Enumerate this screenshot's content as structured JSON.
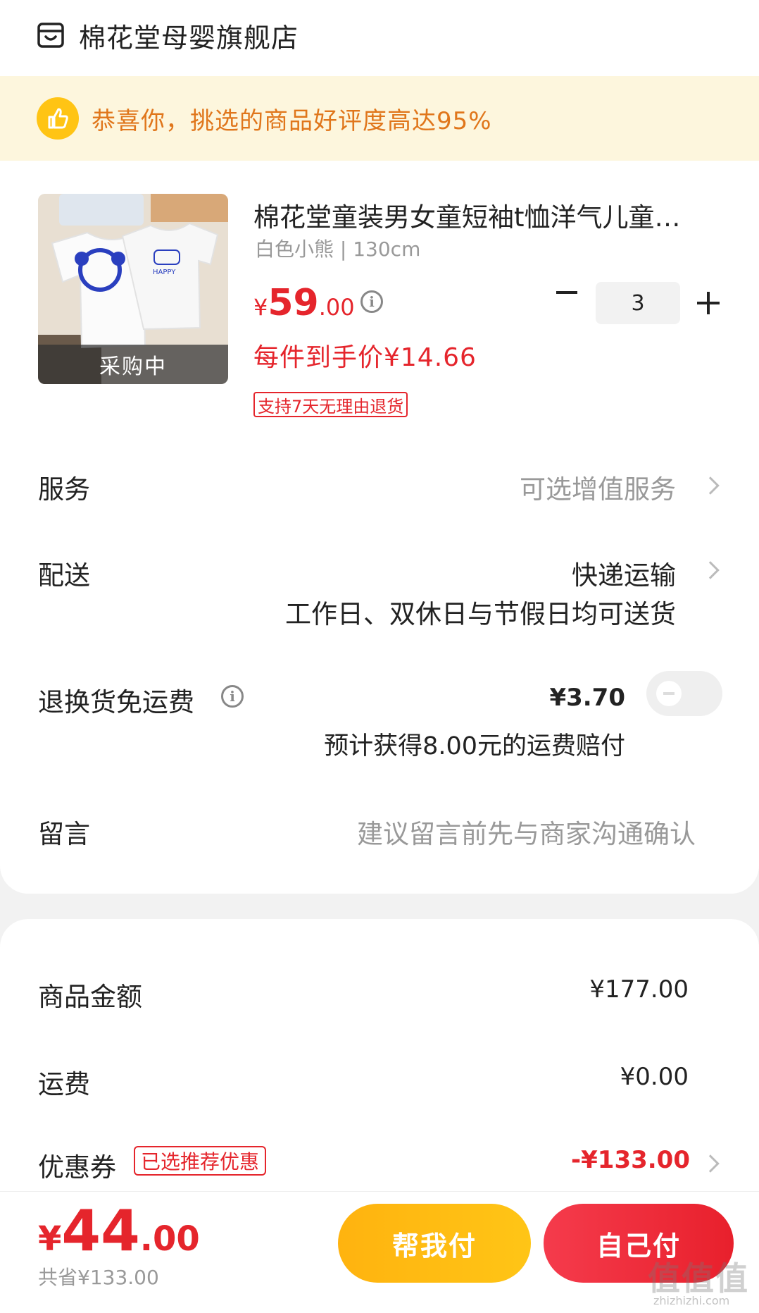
{
  "shop": {
    "name": "棉花堂母婴旗舰店",
    "icon": "store-icon"
  },
  "banner": {
    "icon": "thumbs-up-icon",
    "text": "恭喜你，挑选的商品好评度高达95%"
  },
  "product": {
    "status": "采购中",
    "title": "棉花堂童装男女童短袖t恤洋气儿童…",
    "spec": "白色小熊 | 130cm",
    "price_symbol": "¥",
    "price_int": "59",
    "price_dec": ".00",
    "each_price": "每件到手价¥14.66",
    "return_tag": "支持7天无理由退货",
    "quantity": "3"
  },
  "service": {
    "label": "服务",
    "value": "可选增值服务"
  },
  "delivery": {
    "label": "配送",
    "value": "快递运输",
    "note": "工作日、双休日与节假日均可送货"
  },
  "return_shipping": {
    "label": "退换货免运费",
    "value": "¥3.70",
    "note": "预计获得8.00元的运费赔付",
    "enabled": false
  },
  "message": {
    "label": "留言",
    "placeholder": "建议留言前先与商家沟通确认"
  },
  "summary": {
    "goods_label": "商品金额",
    "goods_value": "¥177.00",
    "shipping_label": "运费",
    "shipping_value": "¥0.00",
    "coupon_label": "优惠券",
    "coupon_tag": "已选推荐优惠",
    "coupon_value": "-¥133.00"
  },
  "footer": {
    "total_symbol": "¥",
    "total_int": "44",
    "total_dec": ".00",
    "saved": "共省¥133.00",
    "help_pay": "帮我付",
    "self_pay": "自己付"
  },
  "watermark": {
    "text": "值值值",
    "sub": "zhizhizhi.com"
  },
  "colors": {
    "accent_red": "#e5252c",
    "banner_bg": "#fdf6dd",
    "banner_text": "#e0761b",
    "help_btn": "#ffb30f",
    "self_btn": "#f53b4c"
  }
}
